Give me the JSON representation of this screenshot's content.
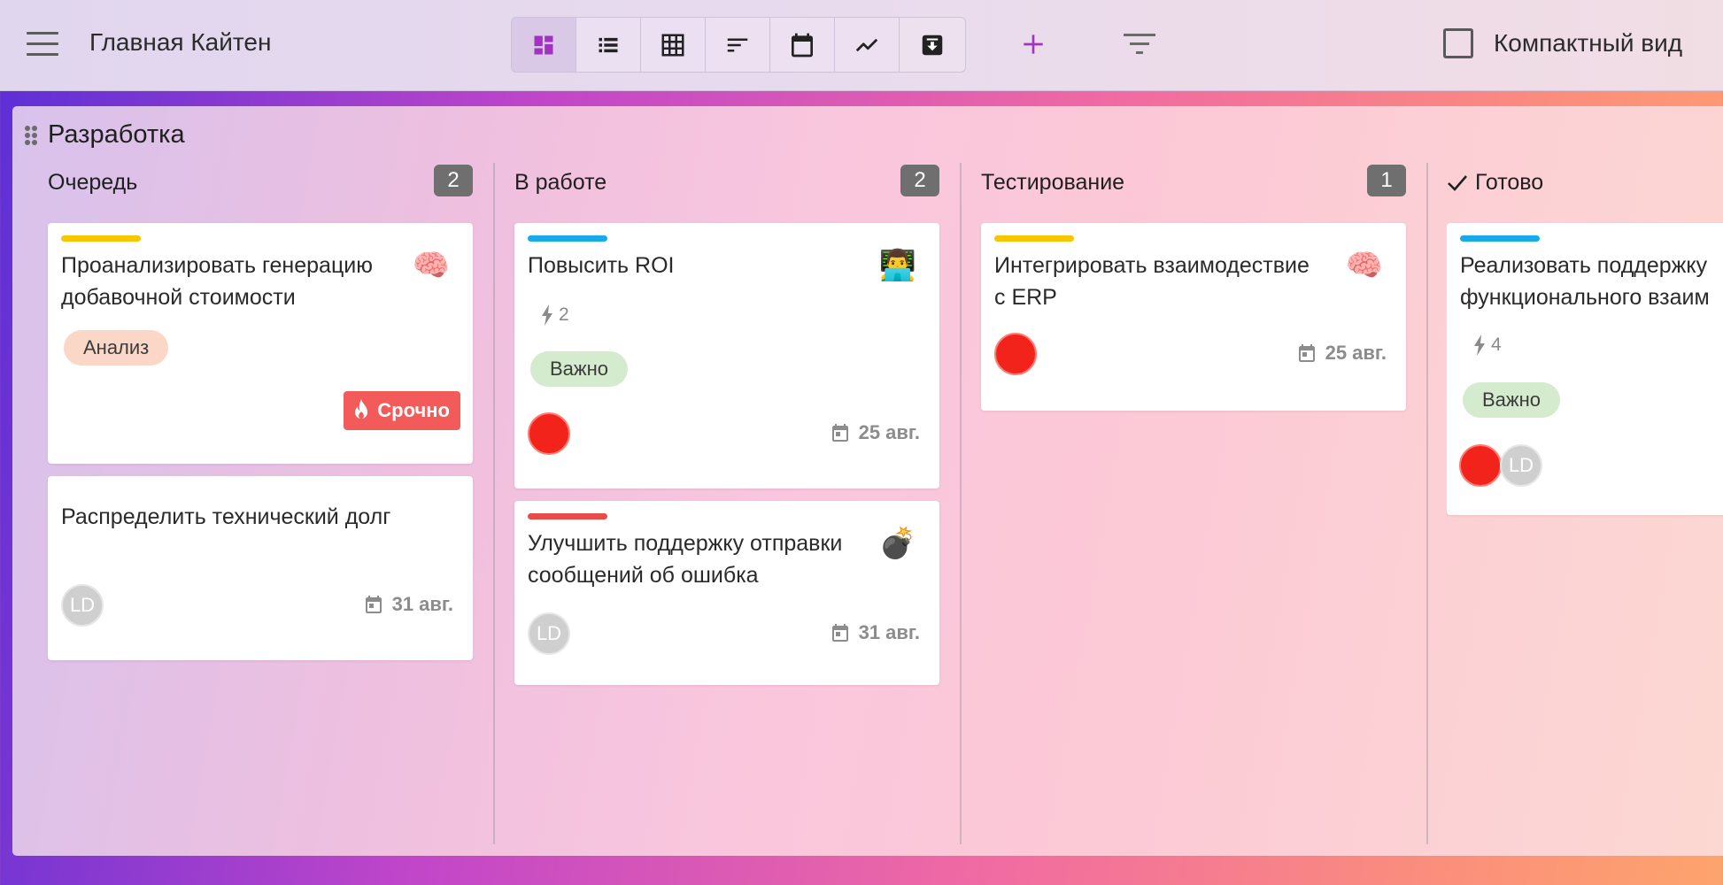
{
  "app": {
    "title": "Главная Кайтен"
  },
  "toolbar": {
    "views": [
      {
        "icon": "board-view-icon",
        "active": true
      },
      {
        "icon": "list-view-icon",
        "active": false
      },
      {
        "icon": "table-view-icon",
        "active": false
      },
      {
        "icon": "timeline-view-icon",
        "active": false
      },
      {
        "icon": "calendar-view-icon",
        "active": false
      },
      {
        "icon": "chart-view-icon",
        "active": false
      },
      {
        "icon": "archive-view-icon",
        "active": false
      }
    ],
    "add_icon": "plus-icon",
    "filter_icon": "filter-icon",
    "compact_label": "Компактный вид",
    "compact_checked": false
  },
  "colors": {
    "accent": "#a233c0",
    "yellow": "#f7c600",
    "blue": "#17a9e8",
    "red": "#e94b4b",
    "count_badge": "#6f6f6f"
  },
  "board": {
    "title": "Разработка",
    "columns": [
      {
        "title": "Очередь",
        "count": "2",
        "done": false,
        "cards": [
          {
            "bar": "yellow",
            "title": "Проанализировать генерацию добавочной стоимости",
            "emoji": "🧠",
            "tag": "Анализ",
            "urgent": "Срочно"
          },
          {
            "title": "Распределить технический долг",
            "avatar": "LD",
            "date": "31 авг."
          }
        ]
      },
      {
        "title": "В работе",
        "count": "2",
        "done": false,
        "cards": [
          {
            "bar": "blue",
            "title": "Повысить ROI",
            "emoji": "👨‍💻",
            "bolt": "2",
            "tag": "Важно",
            "date": "25 авг."
          },
          {
            "bar": "red",
            "title": "Улучшить поддержку отправки сообщений об ошибка",
            "emoji": "💣",
            "avatar": "LD",
            "date": "31 авг."
          }
        ]
      },
      {
        "title": "Тестирование",
        "count": "1",
        "done": false,
        "cards": [
          {
            "bar": "yellow",
            "title": "Интегрировать взаимодествие с ERP",
            "emoji": "🧠",
            "date": "25 авг."
          }
        ]
      },
      {
        "title": "Готово",
        "count": "",
        "done": true,
        "cards": [
          {
            "bar": "blue",
            "title": "Реализовать поддержку функционального взаим",
            "bolt": "4",
            "tag": "Важно",
            "avatar": "LD"
          }
        ]
      }
    ]
  }
}
